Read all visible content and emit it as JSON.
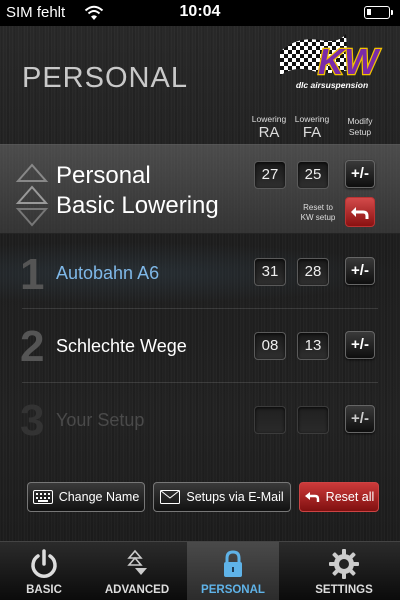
{
  "status": {
    "carrier": "SIM fehlt",
    "time": "10:04"
  },
  "header": {
    "title": "PERSONAL",
    "logo_text": "KW",
    "logo_tagline": "dlc airsuspension"
  },
  "columns": {
    "ra_small": "Lowering",
    "ra": "RA",
    "fa_small": "Lowering",
    "fa": "FA",
    "modify_1": "Modify",
    "modify_2": "Setup"
  },
  "base": {
    "title_1": "Personal",
    "title_2": "Basic Lowering",
    "ra": "27",
    "fa": "25",
    "modify_label": "+/-",
    "reset_label_1": "Reset to",
    "reset_label_2": "KW setup"
  },
  "setups": [
    {
      "number": "1",
      "name": "Autobahn A6",
      "ra": "31",
      "fa": "28",
      "modify_label": "+/-"
    },
    {
      "number": "2",
      "name": "Schlechte Wege",
      "ra": "08",
      "fa": "13",
      "modify_label": "+/-"
    },
    {
      "number": "3",
      "name": "Your Setup",
      "ra": "",
      "fa": "",
      "modify_label": "+/-"
    }
  ],
  "actions": {
    "change_name": "Change Name",
    "email": "Setups via E-Mail",
    "reset_all": "Reset all"
  },
  "tabs": [
    {
      "label": "BASIC"
    },
    {
      "label": "ADVANCED"
    },
    {
      "label": "PERSONAL"
    },
    {
      "label": "SETTINGS"
    }
  ],
  "colors": {
    "accent": "#5fb3e8",
    "active_name": "#7fb8e8",
    "danger": "#b31c1c"
  }
}
